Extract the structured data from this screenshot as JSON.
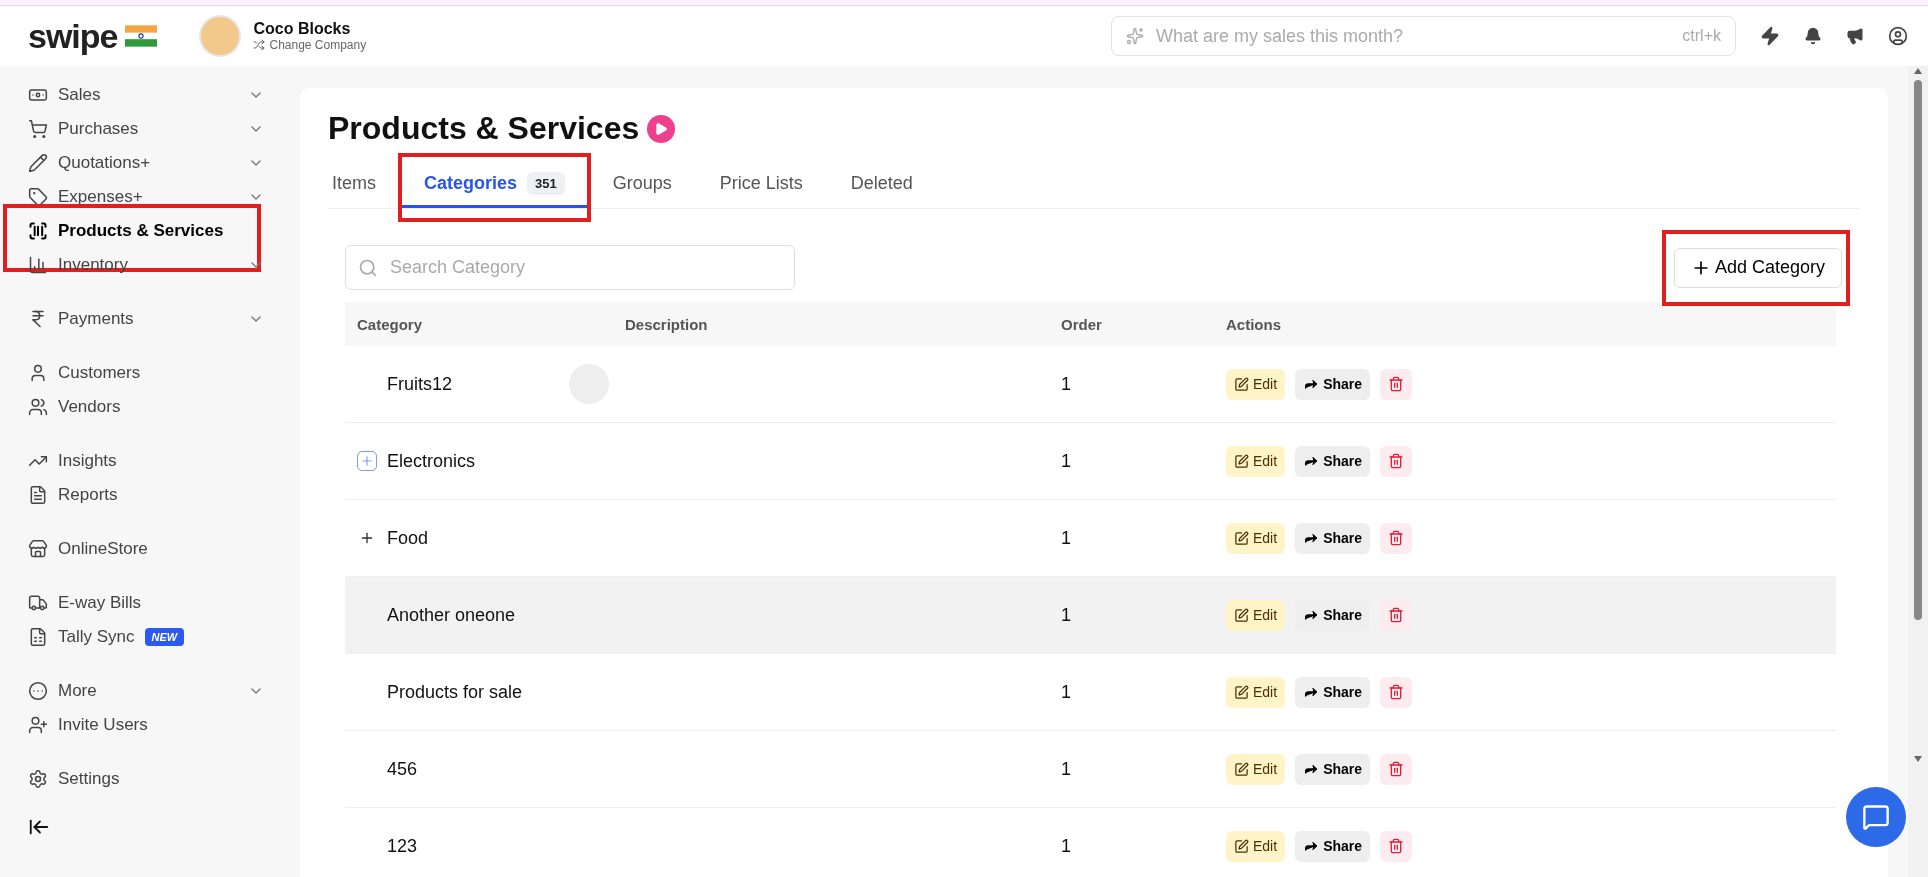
{
  "header": {
    "logo": "swipe",
    "company": "Coco Blocks",
    "change_company": "Change Company",
    "search": {
      "placeholder": "What are my sales this month?",
      "shortcut": "ctrl+k"
    }
  },
  "sidebar": {
    "groups": [
      {
        "items": [
          {
            "label": "Sales",
            "expandable": true,
            "active": false,
            "highlighted": false
          },
          {
            "label": "Purchases",
            "expandable": true,
            "active": false,
            "highlighted": false
          },
          {
            "label": "Quotations+",
            "expandable": true,
            "active": false,
            "highlighted": false
          },
          {
            "label": "Expenses+",
            "expandable": true,
            "active": false,
            "highlighted": false
          },
          {
            "label": "Products & Services",
            "expandable": false,
            "active": true,
            "highlighted": true
          },
          {
            "label": "Inventory",
            "expandable": true,
            "active": false,
            "highlighted": false
          }
        ]
      },
      {
        "items": [
          {
            "label": "Payments",
            "expandable": true,
            "active": false,
            "highlighted": false
          }
        ]
      },
      {
        "items": [
          {
            "label": "Customers",
            "expandable": false,
            "active": false,
            "highlighted": false
          },
          {
            "label": "Vendors",
            "expandable": false,
            "active": false,
            "highlighted": false
          }
        ]
      },
      {
        "items": [
          {
            "label": "Insights",
            "expandable": false,
            "active": false,
            "highlighted": false
          },
          {
            "label": "Reports",
            "expandable": false,
            "active": false,
            "highlighted": false
          }
        ]
      },
      {
        "items": [
          {
            "label": "OnlineStore",
            "expandable": false,
            "active": false,
            "highlighted": false
          }
        ]
      },
      {
        "items": [
          {
            "label": "E-way Bills",
            "expandable": false,
            "active": false,
            "highlighted": false
          },
          {
            "label": "Tally Sync",
            "expandable": false,
            "active": false,
            "highlighted": false,
            "badge": "NEW"
          }
        ]
      },
      {
        "items": [
          {
            "label": "More",
            "expandable": true,
            "active": false,
            "highlighted": false
          },
          {
            "label": "Invite Users",
            "expandable": false,
            "active": false,
            "highlighted": false
          }
        ]
      },
      {
        "items": [
          {
            "label": "Settings",
            "expandable": false,
            "active": false,
            "highlighted": false
          }
        ]
      }
    ]
  },
  "page": {
    "title": "Products & Services",
    "tabs": [
      {
        "label": "Items",
        "selected": false,
        "highlighted": false
      },
      {
        "label": "Categories",
        "count": "351",
        "selected": true,
        "highlighted": true
      },
      {
        "label": "Groups",
        "selected": false,
        "highlighted": false
      },
      {
        "label": "Price Lists",
        "selected": false,
        "highlighted": false
      },
      {
        "label": "Deleted",
        "selected": false,
        "highlighted": false
      }
    ],
    "search": {
      "placeholder": "Search Category"
    },
    "add_button": {
      "label": "Add Category",
      "highlighted": true
    },
    "table": {
      "columns": [
        "Category",
        "Description",
        "Order",
        "Actions"
      ],
      "rows": [
        {
          "name": "Fruits12",
          "kind": "leaf",
          "image": true,
          "order": "1",
          "hovered": false,
          "actions": [
            "Edit",
            "Share"
          ]
        },
        {
          "name": "Electronics",
          "kind": "boxed",
          "image": false,
          "order": "1",
          "hovered": false,
          "actions": [
            "Edit",
            "Share"
          ]
        },
        {
          "name": "Food",
          "kind": "plain",
          "image": false,
          "order": "1",
          "hovered": false,
          "actions": [
            "Edit",
            "Share"
          ]
        },
        {
          "name": "Another oneone",
          "kind": "leaf",
          "image": false,
          "order": "1",
          "hovered": true,
          "actions": [
            "Edit",
            "Share"
          ]
        },
        {
          "name": "Products for sale",
          "kind": "leaf",
          "image": false,
          "order": "1",
          "hovered": false,
          "actions": [
            "Edit",
            "Share"
          ]
        },
        {
          "name": "456",
          "kind": "leaf",
          "image": false,
          "order": "1",
          "hovered": false,
          "actions": [
            "Edit",
            "Share"
          ]
        },
        {
          "name": "123",
          "kind": "leaf",
          "image": false,
          "order": "1",
          "hovered": false,
          "actions": [
            "Edit",
            "Share"
          ]
        }
      ]
    }
  }
}
